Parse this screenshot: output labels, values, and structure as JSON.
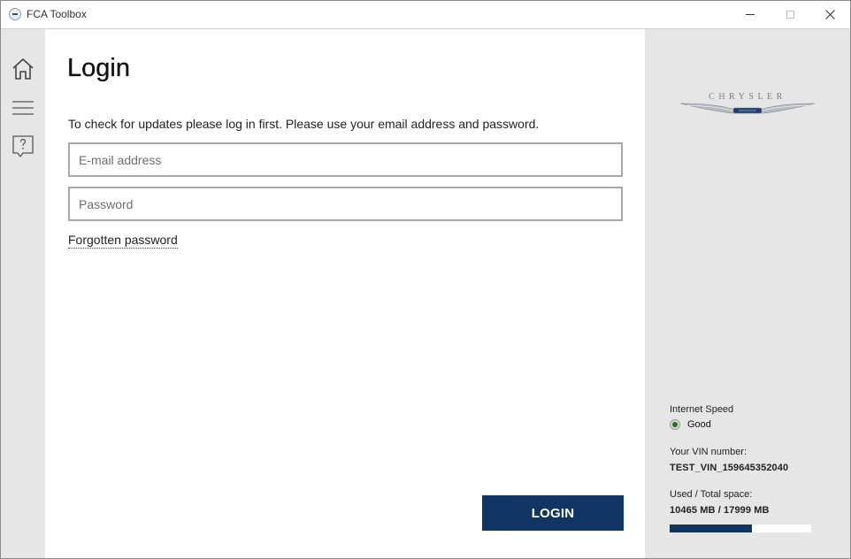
{
  "window": {
    "title": "FCA Toolbox",
    "minimize_icon": "minimize-icon",
    "maximize_icon": "maximize-icon",
    "close_icon": "close-icon"
  },
  "nav": {
    "items": [
      {
        "icon": "home-icon"
      },
      {
        "icon": "menu-icon"
      },
      {
        "icon": "help-icon"
      }
    ]
  },
  "main": {
    "title": "Login",
    "intro": "To check for updates please log in first. Please use your email address and password.",
    "email_placeholder": "E-mail address",
    "email_value": "",
    "password_placeholder": "Password",
    "password_value": "",
    "forgot_label": "Forgotten password",
    "login_label": "LOGIN"
  },
  "status": {
    "brand_logo_text": "CHRYSLER",
    "internet_speed_label": "Internet Speed",
    "internet_speed_value": "Good",
    "vin_label": "Your VIN number:",
    "vin_value": "TEST_VIN_159645352040",
    "space_label": "Used / Total space:",
    "space_value": "10465 MB / 17999 MB",
    "space_used_fraction": 0.581
  },
  "colors": {
    "accent": "#0e3564",
    "status_good": "#1a7a1a"
  }
}
